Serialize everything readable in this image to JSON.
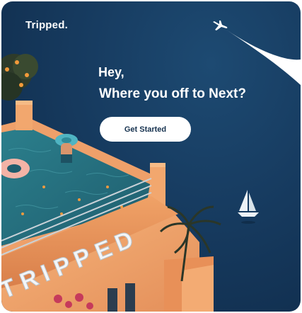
{
  "brand": {
    "name": "Tripped."
  },
  "hero": {
    "greeting": "Hey,",
    "headline": "Where you off to Next?",
    "cta_label": "Get Started"
  },
  "illustration": {
    "sign_text": "TRIPPED",
    "icons": [
      "airplane-icon",
      "sailboat-icon"
    ]
  },
  "colors": {
    "background": "#143759",
    "button": "#ffffff",
    "button_text": "#16324f",
    "building": "#f2a66a",
    "pool": "#2f7f8e"
  }
}
